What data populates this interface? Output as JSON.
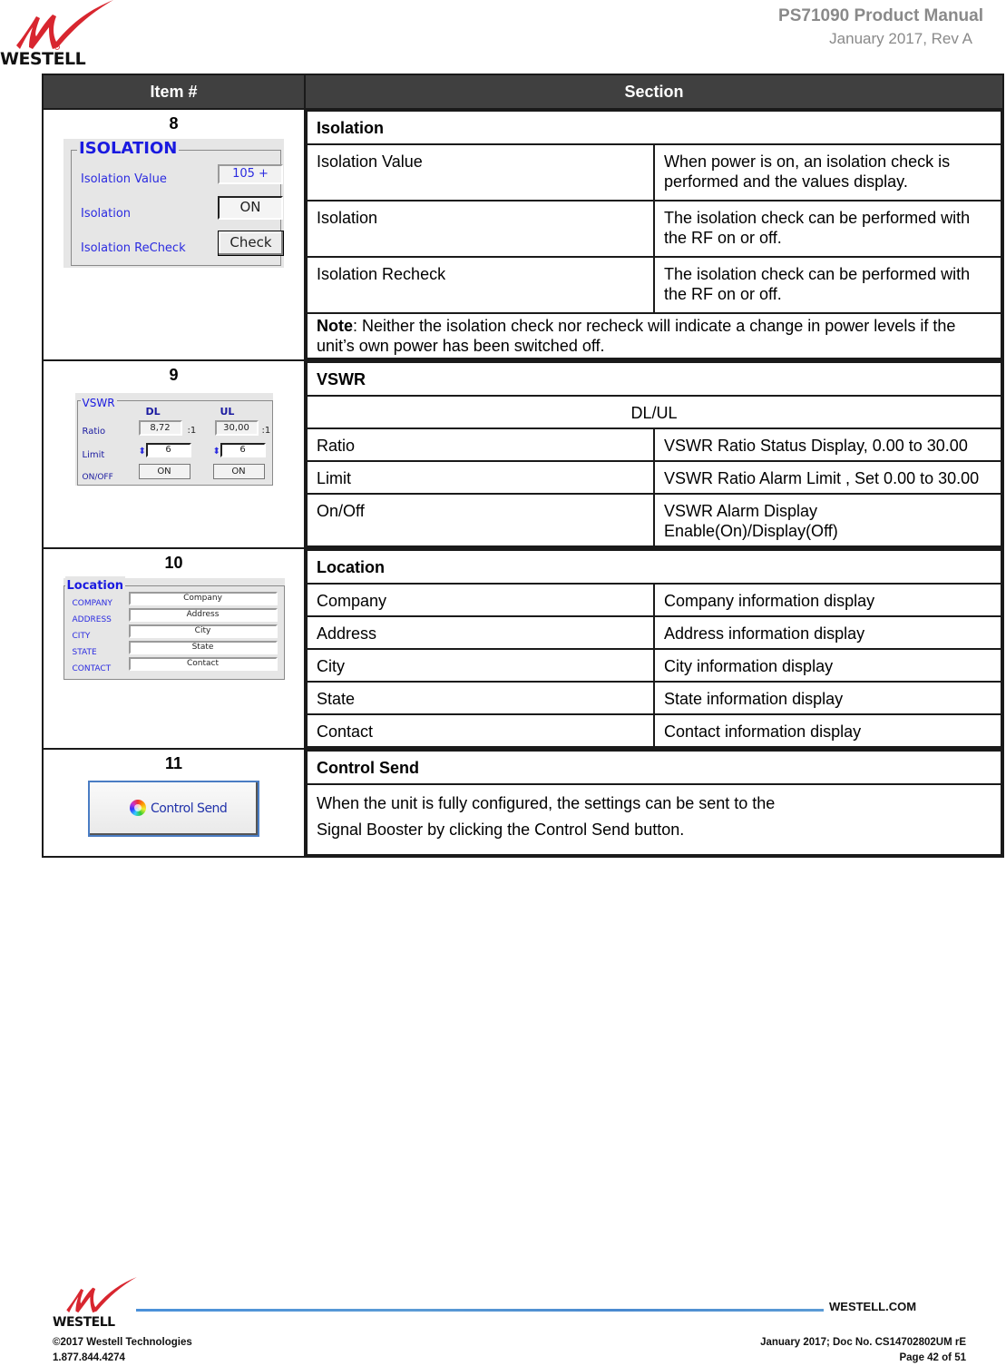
{
  "header": {
    "logo_text": "WESTELL",
    "doc_title": "PS71090 Product Manual",
    "doc_revision": "January 2017, Rev A"
  },
  "table": {
    "headers": {
      "item": "Item #",
      "section": "Section"
    },
    "rows": [
      {
        "item": "8",
        "section_title": "Isolation",
        "widget": {
          "legend": "ISOLATION",
          "labels": [
            "Isolation Value",
            "Isolation",
            "Isolation ReCheck"
          ],
          "value": "105 +",
          "toggle": "ON",
          "button": "Check"
        },
        "entries": [
          {
            "label": "Isolation Value",
            "desc": "When power is on, an isolation check is performed and the values display."
          },
          {
            "label": "Isolation",
            "desc": "The isolation check can be performed with the RF on or off."
          },
          {
            "label": "Isolation Recheck",
            "desc": "The isolation check can be performed with the RF on or off."
          }
        ],
        "note_label": "Note",
        "note_text": ":  Neither the isolation check nor recheck will indicate a change in power levels if the unit’s own power has been switched off."
      },
      {
        "item": "9",
        "section_title": "VSWR",
        "subheader": "DL/UL",
        "widget": {
          "legend": "VSWR",
          "col_dl": "DL",
          "col_ul": "UL",
          "labels": [
            "Ratio",
            "Limit",
            "ON/OFF"
          ],
          "ratio_dl": "8,72",
          "ratio_ul": "30,00",
          "ratio_suffix": ":1",
          "limit_dl": "6",
          "limit_ul": "6",
          "onoff_dl": "ON",
          "onoff_ul": "ON"
        },
        "entries": [
          {
            "label": "Ratio",
            "desc": "VSWR Ratio Status Display, 0.00 to 30.00"
          },
          {
            "label": "Limit",
            "desc": "VSWR Ratio Alarm Limit , Set 0.00 to 30.00"
          },
          {
            "label": "On/Off",
            "desc": "VSWR Alarm Display Enable(On)/Display(Off)"
          }
        ]
      },
      {
        "item": "10",
        "section_title": "Location",
        "widget": {
          "legend": "Location",
          "labels": [
            "COMPANY",
            "ADDRESS",
            "CITY",
            "STATE",
            "CONTACT"
          ],
          "values": [
            "Company",
            "Address",
            "City",
            "State",
            "Contact"
          ]
        },
        "entries": [
          {
            "label": "Company",
            "desc": "Company information display"
          },
          {
            "label": "Address",
            "desc": "Address information display"
          },
          {
            "label": "City",
            "desc": "City information display"
          },
          {
            "label": "State",
            "desc": "State information display"
          },
          {
            "label": "Contact",
            "desc": "Contact information display"
          }
        ]
      },
      {
        "item": "11",
        "section_title": "Control Send",
        "widget": {
          "button": "Control Send"
        },
        "desc_line1": "When the unit is fully configured, the settings can be sent to the",
        "desc_line2": "Signal Booster by clicking the Control Send button."
      }
    ]
  },
  "footer": {
    "logo_text": "WESTELL",
    "url": "WESTELL.COM",
    "copyright": "©2017 Westell Technologies",
    "phone": "1.877.844.4274",
    "doc_info": "January 2017; Doc No. CS14702802UM rE",
    "page": "Page 42 of 51"
  }
}
